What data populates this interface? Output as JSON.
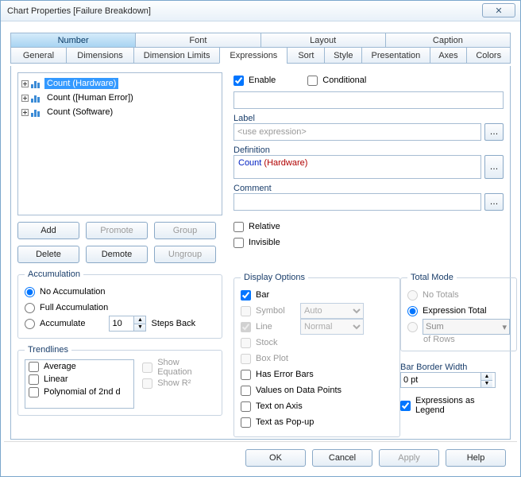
{
  "title": "Chart Properties [Failure Breakdown]",
  "tabs_row1": [
    "Number",
    "Font",
    "Layout",
    "Caption"
  ],
  "tabs_row2": [
    "General",
    "Dimensions",
    "Dimension Limits",
    "Expressions",
    "Sort",
    "Style",
    "Presentation",
    "Axes",
    "Colors"
  ],
  "active_tab": "Expressions",
  "tree": [
    {
      "label": "Count (Hardware)",
      "selected": true
    },
    {
      "label": "Count ([Human Error])",
      "selected": false
    },
    {
      "label": "Count (Software)",
      "selected": false
    }
  ],
  "buttons_left": {
    "add": "Add",
    "promote": "Promote",
    "group": "Group",
    "delete": "Delete",
    "demote": "Demote",
    "ungroup": "Ungroup"
  },
  "accumulation": {
    "legend": "Accumulation",
    "none": "No Accumulation",
    "full": "Full Accumulation",
    "acc": "Accumulate",
    "stepsback": "Steps Back",
    "value": "10"
  },
  "trendlines": {
    "legend": "Trendlines",
    "items": [
      "Average",
      "Linear",
      "Polynomial of 2nd d"
    ],
    "show_eq": "Show Equation",
    "show_r2": "Show R²"
  },
  "enable": "Enable",
  "conditional": "Conditional",
  "label_lbl": "Label",
  "label_ph": "<use expression>",
  "definition_lbl": "Definition",
  "definition_val1": "Count ",
  "definition_val2": "(Hardware)",
  "comment_lbl": "Comment",
  "relative": "Relative",
  "invisible": "Invisible",
  "display_options": {
    "legend": "Display Options",
    "bar": "Bar",
    "symbol": "Symbol",
    "symbol_sel": "Auto",
    "line": "Line",
    "line_sel": "Normal",
    "stock": "Stock",
    "boxplot": "Box Plot",
    "errbars": "Has Error Bars",
    "vdp": "Values on Data Points",
    "toa": "Text on Axis",
    "tap": "Text as Pop-up"
  },
  "total_mode": {
    "legend": "Total Mode",
    "none": "No Totals",
    "expr": "Expression Total",
    "sum": "Sum",
    "of_rows": "of Rows"
  },
  "bar_border": {
    "lbl": "Bar Border Width",
    "val": "0 pt"
  },
  "expr_legend": "Expressions as Legend",
  "footer": {
    "ok": "OK",
    "cancel": "Cancel",
    "apply": "Apply",
    "help": "Help"
  }
}
